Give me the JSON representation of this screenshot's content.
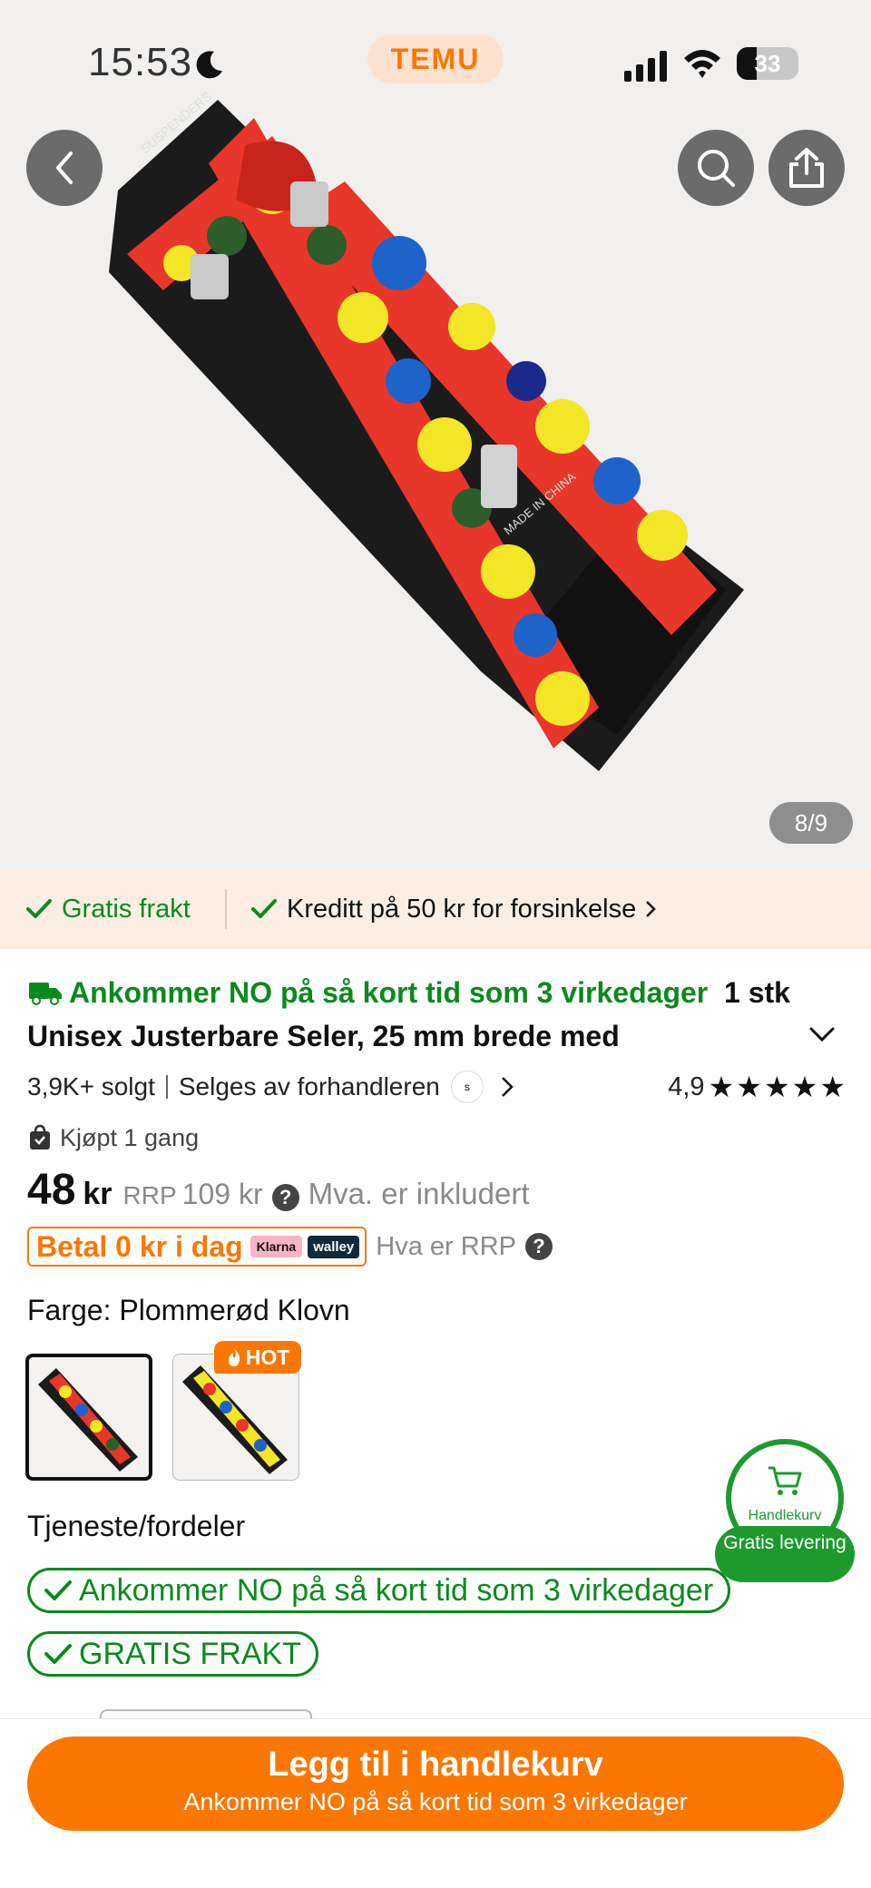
{
  "status_bar": {
    "time": "15:53",
    "brand": "TEMU",
    "battery": "33",
    "battery_level": 0.33
  },
  "gallery": {
    "counter": "8/9",
    "image_text_left": "SUSPENDERS",
    "image_text_right": "MADE IN CHINA"
  },
  "benefits": {
    "free_shipping": "Gratis frakt",
    "delay_credit": "Kreditt på 50 kr for forsinkelse"
  },
  "product": {
    "arrival_text": "Ankommer NO på så kort tid som 3 virkedager",
    "title": "1 stk Unisex Justerbare Seler, 25 mm brede med",
    "sold": "3,9K+ solgt",
    "seller": "Selges av forhandleren",
    "rating": "4,9",
    "stars": 5,
    "bought": "Kjøpt 1 gang"
  },
  "price": {
    "value": "48",
    "currency": "kr",
    "rrp_label": "RRP",
    "rrp_value": "109 kr",
    "vat_text": "Mva. er inkludert",
    "pay_today": "Betal 0 kr i dag",
    "klarna": "Klarna",
    "walley": "walley",
    "rrp_what": "Hva er RRP"
  },
  "color": {
    "label": "Farge: Plommerød Klovn",
    "hot_badge": "HOT"
  },
  "service": {
    "label": "Tjeneste/fordeler",
    "pill_arrival": "Ankommer NO på så kort tid som 3 virkedager",
    "pill_free": "GRATIS FRAKT"
  },
  "cart_float": {
    "label": "Handlekurv",
    "free_delivery": "Gratis levering"
  },
  "cta": {
    "main": "Legg til i handlekurv",
    "sub": "Ankommer NO på så kort tid som 3 virkedager"
  },
  "colors": {
    "brand_orange": "#fb7701",
    "success_green": "#0a8a1d",
    "strip_bg": "#fdeee4"
  }
}
